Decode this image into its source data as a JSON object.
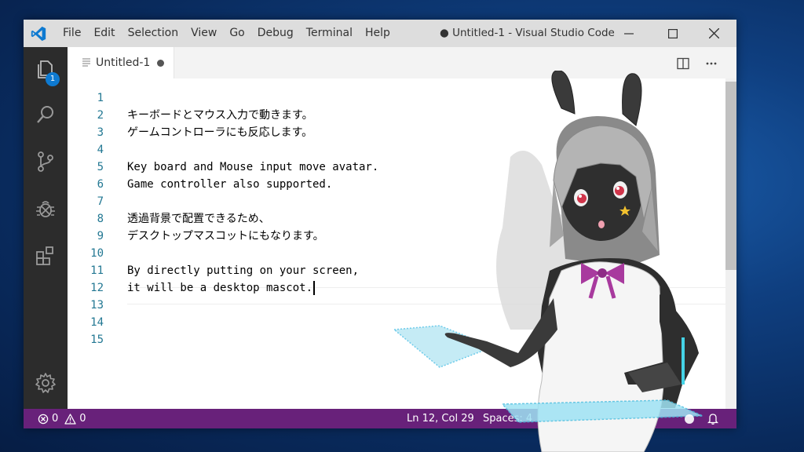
{
  "menu": [
    "File",
    "Edit",
    "Selection",
    "View",
    "Go",
    "Debug",
    "Terminal",
    "Help"
  ],
  "window_title": "● Untitled-1 - Visual Studio Code",
  "activity": {
    "explorer_badge": "1"
  },
  "tab": {
    "label": "Untitled-1"
  },
  "editor": {
    "lines": [
      "",
      "キーボードとマウス入力で動きます。",
      "ゲームコントローラにも反応します。",
      "",
      "Key board and Mouse input move avatar.",
      "Game controller also supported.",
      "",
      "透過背景で配置できるため、",
      "デスクトップマスコットにもなります。",
      "",
      "By directly putting on your screen,",
      "it will be a desktop mascot.",
      "",
      "",
      ""
    ],
    "line_numbers": [
      "1",
      "2",
      "3",
      "4",
      "5",
      "6",
      "7",
      "8",
      "9",
      "10",
      "11",
      "12",
      "13",
      "14",
      "15"
    ]
  },
  "status": {
    "errors": "0",
    "warnings": "0",
    "position": "Ln 12, Col 29",
    "spaces": "Spaces: 4"
  },
  "colors": {
    "status_bar": "#68217a",
    "vscode_blue": "#0e7ad1"
  }
}
